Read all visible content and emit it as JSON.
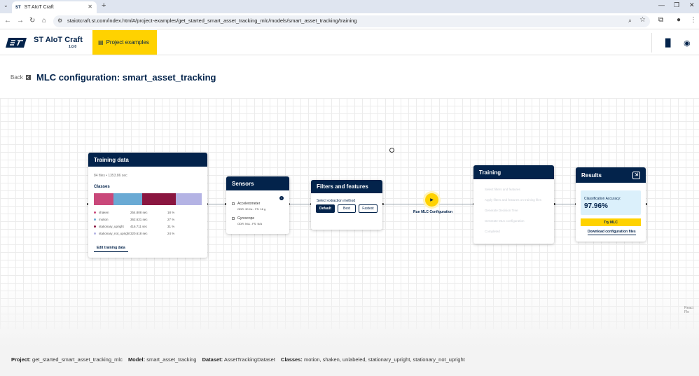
{
  "browser": {
    "tab_title": "ST AIoT Craft",
    "new_tab": "+",
    "url": "staiotcraft.st.com/index.html#/project-examples/get_started_smart_asset_tracking_mlc/models/smart_asset_tracking/training"
  },
  "header": {
    "app_title": "ST AIoT Craft",
    "version": "1.0.0",
    "project_examples_label": "Project examples"
  },
  "page": {
    "back_label": "Back",
    "title": "MLC configuration: smart_asset_tracking"
  },
  "training_data": {
    "title": "Training data",
    "summary": "84 files • 1353.86 sec",
    "classes_label": "Classes",
    "bar_colors": [
      "#c9487a",
      "#6aaad4",
      "#8a1640",
      "#b4b3e4"
    ],
    "bar_fractions": [
      0.18,
      0.27,
      0.31,
      0.24
    ],
    "classes": [
      {
        "name": "shaken",
        "duration": "254.808 sec",
        "percent": "18 %",
        "color": "#c9487a"
      },
      {
        "name": "motion",
        "duration": "362.631 sec",
        "percent": "27 %",
        "color": "#6aaad4"
      },
      {
        "name": "stationary_upright",
        "duration": "416.711 sec",
        "percent": "31 %",
        "color": "#8a1640"
      },
      {
        "name": "stationary_not_upright",
        "duration": "320.618 sec",
        "percent": "24 %",
        "color": "#b4b3e4"
      }
    ],
    "edit_label": "Edit training data"
  },
  "sensors": {
    "title": "Sensors",
    "items": [
      {
        "name": "Accelerometer",
        "odr": "ODR: 30 Hz - FS: 16 g"
      },
      {
        "name": "Gyroscope",
        "odr": "ODR: N/A - FS: N/A"
      }
    ]
  },
  "filters": {
    "title": "Filters and features",
    "method_label": "Select extraction method",
    "buttons": [
      "Default",
      "Best",
      "Fastest"
    ]
  },
  "run": {
    "label": "Run MLC Configuration"
  },
  "training": {
    "title": "Training",
    "steps": [
      "Select filters and features",
      "Apply filters and features on training files",
      "Generate Decision Tree",
      "Generate MLC configuration",
      "Completed"
    ]
  },
  "results": {
    "title": "Results",
    "accuracy_label": "Classification Accuracy:",
    "accuracy_value": "97.96%",
    "try_label": "Try MLC",
    "download_label": "Download configuration files"
  },
  "canvas": {
    "attribution": "React Flo"
  },
  "footer": {
    "project_label": "Project:",
    "project_value": "get_started_smart_asset_tracking_mlc",
    "model_label": "Model:",
    "model_value": "smart_asset_tracking",
    "dataset_label": "Dataset:",
    "dataset_value": "AssetTrackingDataset",
    "classes_label": "Classes:",
    "classes_value": "motion, shaken, unlabeled, stationary_upright, stationary_not_upright"
  }
}
